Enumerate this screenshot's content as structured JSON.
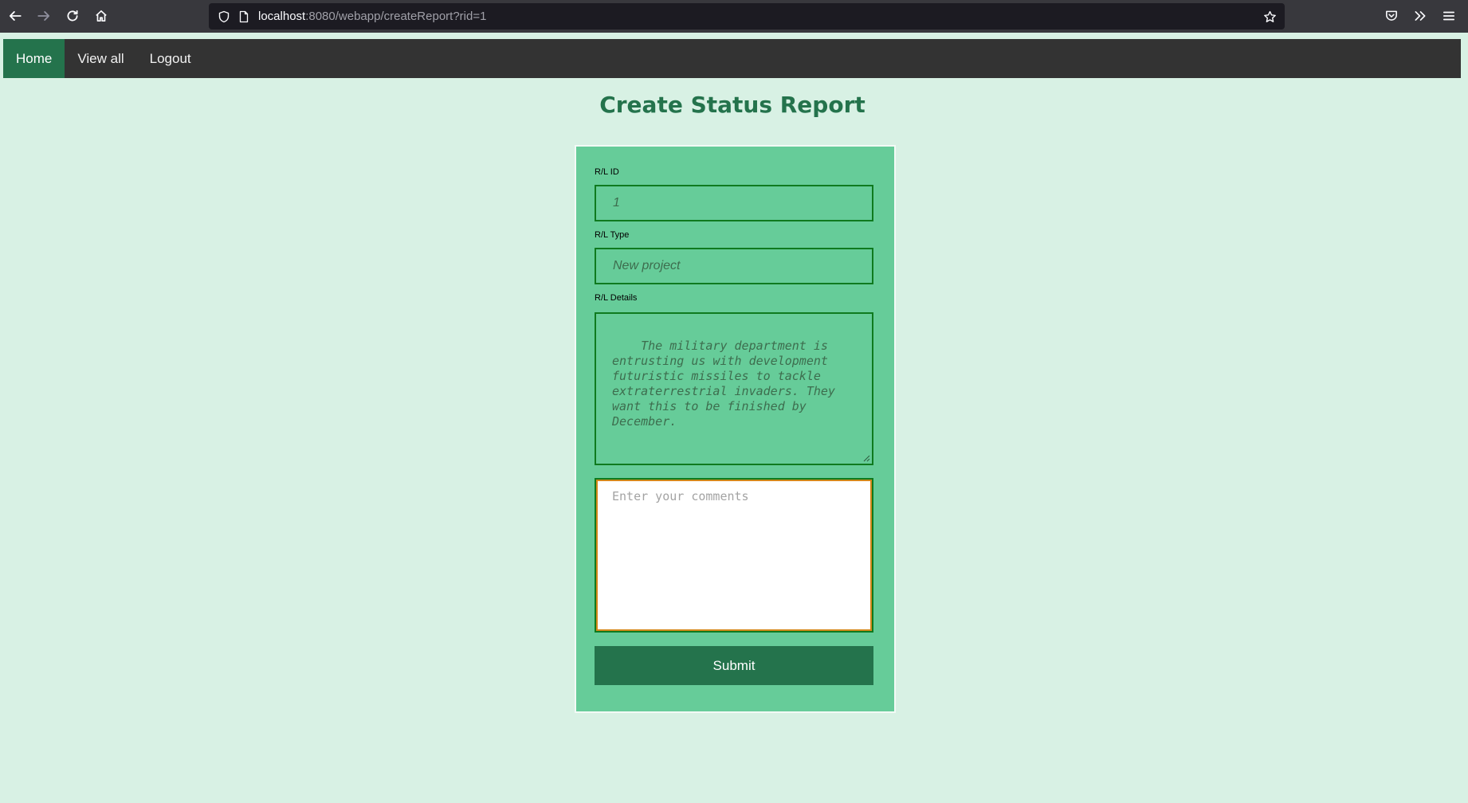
{
  "browser": {
    "url_host": "localhost",
    "url_rest": ":8080/webapp/createReport?rid=1"
  },
  "nav": {
    "items": [
      {
        "label": "Home",
        "active": true
      },
      {
        "label": "View all",
        "active": false
      },
      {
        "label": "Logout",
        "active": false
      }
    ]
  },
  "page": {
    "title": "Create Status Report"
  },
  "form": {
    "id_label": "R/L ID",
    "id_value": "1",
    "type_label": "R/L Type",
    "type_value": "New project",
    "details_label": "R/L Details",
    "details_value": "The military department is\nentrusting us with development\nfuturistic missiles to tackle\nextraterrestrial invaders. They\nwant this to be finished by\nDecember.",
    "comments_placeholder": "Enter your comments",
    "submit_label": "Submit"
  },
  "colors": {
    "accent": "#24734c",
    "card": "#66cc99",
    "page_bg": "#d8f1e4",
    "nav_bg": "#333333"
  }
}
